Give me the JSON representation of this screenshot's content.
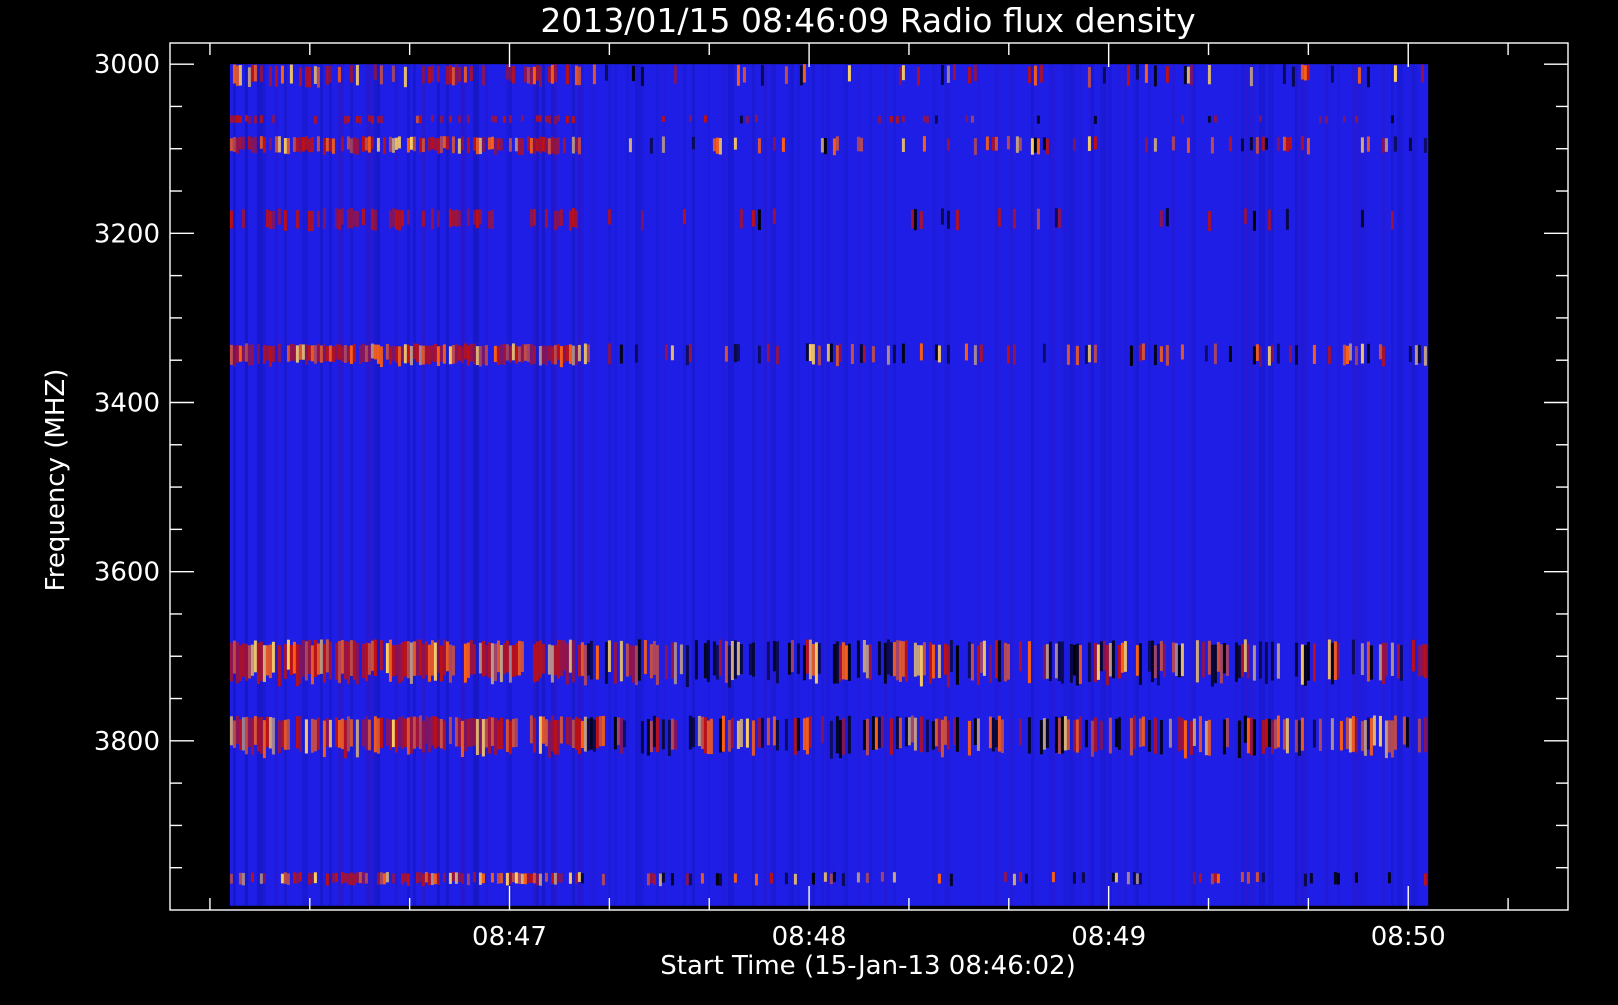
{
  "chart_data": {
    "type": "heatmap",
    "title": "2013/01/15 08:46:09 Radio flux density",
    "xlabel": "Start Time (15-Jan-13 08:46:02)",
    "ylabel": "Frequency (MHZ)",
    "x_range_seconds_after_start": [
      -10,
      270
    ],
    "x_tick_labels": [
      "08:47",
      "08:48",
      "08:49",
      "08:50"
    ],
    "x_tick_seconds_after_start": [
      58,
      118,
      178,
      238
    ],
    "y_range_mhz": [
      2975,
      4000
    ],
    "y_tick_labels": [
      "3000",
      "3200",
      "3400",
      "3600",
      "3800"
    ],
    "y_ticks_mhz": [
      3000,
      3200,
      3400,
      3600,
      3800
    ],
    "data_time_range_seconds_after_start": [
      2,
      242
    ],
    "data_frequency_range_mhz": [
      3000,
      3995
    ],
    "background_color": "#1e1ee6",
    "colormap": [
      "#000000",
      "#1e1ee6",
      "#c01010",
      "#ff6010",
      "#ffd060"
    ],
    "active_emission_end_seconds_after_start": 72,
    "emission_bands": [
      {
        "freq_from": 3000,
        "freq_to": 3025,
        "intensity": 0.55
      },
      {
        "freq_from": 3060,
        "freq_to": 3070,
        "intensity": 0.35
      },
      {
        "freq_from": 3085,
        "freq_to": 3105,
        "intensity": 0.85
      },
      {
        "freq_from": 3170,
        "freq_to": 3195,
        "intensity": 0.4
      },
      {
        "freq_from": 3330,
        "freq_to": 3355,
        "intensity": 1.0
      },
      {
        "freq_from": 3680,
        "freq_to": 3730,
        "intensity": 0.95
      },
      {
        "freq_from": 3770,
        "freq_to": 3815,
        "intensity": 0.9
      },
      {
        "freq_from": 3955,
        "freq_to": 3970,
        "intensity": 0.75
      }
    ]
  }
}
